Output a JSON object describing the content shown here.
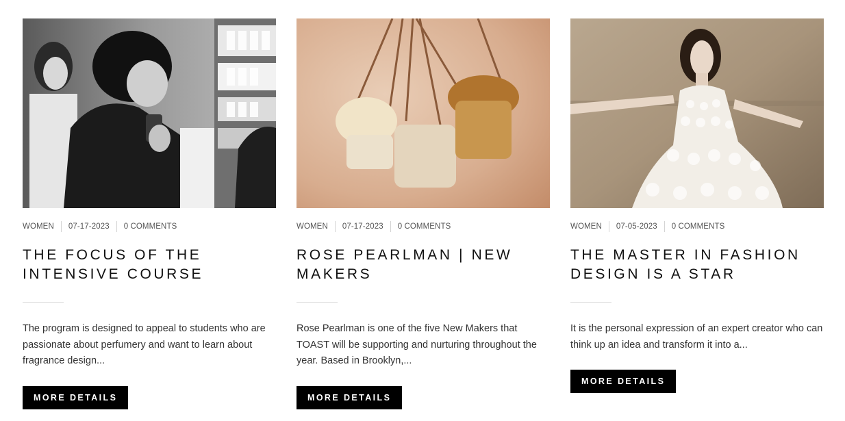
{
  "posts": [
    {
      "category": "WOMEN",
      "date": "07-17-2023",
      "comments": "0 COMMENTS",
      "title": "THE FOCUS OF THE INTENSIVE COURSE",
      "excerpt": "The program is designed to appeal to students who are passionate about perfumery and want to learn about fragrance design...",
      "button": "MORE DETAILS",
      "image": "perfumery-students-photo"
    },
    {
      "category": "WOMEN",
      "date": "07-17-2023",
      "comments": "0 COMMENTS",
      "title": "ROSE PEARLMAN | NEW MAKERS",
      "excerpt": "Rose Pearlman is one of the five New Makers that TOAST will be supporting and nurturing throughout the year. Based in Brooklyn,...",
      "button": "MORE DETAILS",
      "image": "handmade-bags-photo"
    },
    {
      "category": "WOMEN",
      "date": "07-05-2023",
      "comments": "0 COMMENTS",
      "title": "THE MASTER IN FASHION DESIGN IS A STAR",
      "excerpt": "It is the personal expression of an expert creator who can think up an idea and transform it into a...",
      "button": "MORE DETAILS",
      "image": "white-dress-model-photo"
    }
  ]
}
